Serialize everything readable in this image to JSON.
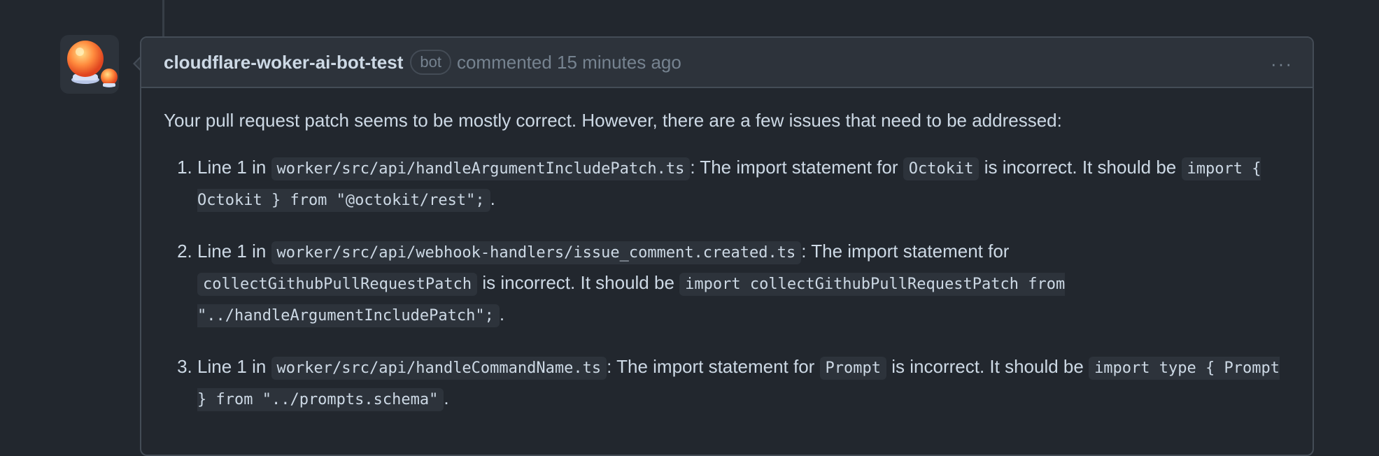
{
  "comment": {
    "author": "cloudflare-woker-ai-bot-test",
    "badge": "bot",
    "meta": "commented 15 minutes ago",
    "menu_glyph": "···",
    "intro": "Your pull request patch seems to be mostly correct. However, there are a few issues that need to be addressed:",
    "items": [
      {
        "t1": "Line 1 in ",
        "c1": "worker/src/api/handleArgumentIncludePatch.ts",
        "t2": ": The import statement for ",
        "c2": "Octokit",
        "t3": " is incorrect. It should be ",
        "c3": "import { Octokit } from \"@octokit/rest\";",
        "t4": "."
      },
      {
        "t1": "Line 1 in ",
        "c1": "worker/src/api/webhook-handlers/issue_comment.created.ts",
        "t2": ": The import statement for ",
        "c2": "collectGithubPullRequestPatch",
        "t3": " is incorrect. It should be ",
        "c3": "import collectGithubPullRequestPatch from \"../handleArgumentIncludePatch\";",
        "t4": "."
      },
      {
        "t1": "Line 1 in ",
        "c1": "worker/src/api/handleCommandName.ts",
        "t2": ": The import statement for ",
        "c2": "Prompt",
        "t3": " is incorrect. It should be ",
        "c3": "import type { Prompt } from \"../prompts.schema\"",
        "t4": "."
      }
    ]
  }
}
